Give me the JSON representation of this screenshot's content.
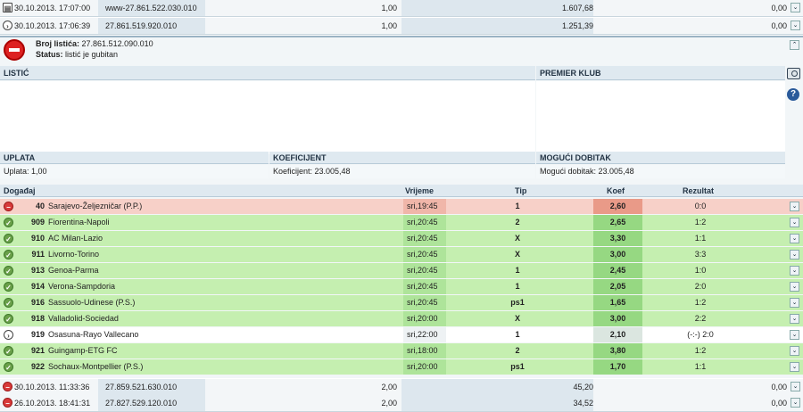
{
  "top_tickets": [
    {
      "status": "print",
      "date": "30.10.2013. 17:07:00",
      "number": "www-27.861.522.030.010",
      "stake": "1,00",
      "win": "1.607,68",
      "paid": "0,00"
    },
    {
      "status": "pending",
      "date": "30.10.2013. 17:06:39",
      "number": "27.861.519.920.010",
      "stake": "1,00",
      "win": "1.251,39",
      "paid": "0,00"
    }
  ],
  "ticket": {
    "number_label": "Broj listića:",
    "number": "27.861.512.090.010",
    "status_label": "Status:",
    "status": "listić je gubitan",
    "listic_header": "LISTIĆ",
    "club_header": "PREMIER KLUB",
    "uplata_header": "UPLATA",
    "uplata_text": "Uplata: 1,00",
    "koef_header": "KOEFICIJENT",
    "koef_text": "Koeficijent: 23.005,48",
    "dobitak_header": "MOGUĆI DOBITAK",
    "dobitak_text": "Mogući dobitak: 23.005,48"
  },
  "events_header": {
    "event": "Događaj",
    "time": "Vrijeme",
    "tip": "Tip",
    "koef": "Koef",
    "result": "Rezultat"
  },
  "events": [
    {
      "status": "lost",
      "code": "40",
      "name": "Sarajevo-Željezničar (P.P.)",
      "time": "sri,19:45",
      "tip": "1",
      "koef": "2,60",
      "result": "0:0"
    },
    {
      "status": "ok",
      "code": "909",
      "name": "Fiorentina-Napoli",
      "time": "sri,20:45",
      "tip": "2",
      "koef": "2,65",
      "result": "1:2"
    },
    {
      "status": "ok",
      "code": "910",
      "name": "AC Milan-Lazio",
      "time": "sri,20:45",
      "tip": "X",
      "koef": "3,30",
      "result": "1:1"
    },
    {
      "status": "ok",
      "code": "911",
      "name": "Livorno-Torino",
      "time": "sri,20:45",
      "tip": "X",
      "koef": "3,00",
      "result": "3:3"
    },
    {
      "status": "ok",
      "code": "913",
      "name": "Genoa-Parma",
      "time": "sri,20:45",
      "tip": "1",
      "koef": "2,45",
      "result": "1:0"
    },
    {
      "status": "ok",
      "code": "914",
      "name": "Verona-Sampdoria",
      "time": "sri,20:45",
      "tip": "1",
      "koef": "2,05",
      "result": "2:0"
    },
    {
      "status": "ok",
      "code": "916",
      "name": "Sassuolo-Udinese (P.S.)",
      "time": "sri,20:45",
      "tip": "ps1",
      "koef": "1,65",
      "result": "1:2"
    },
    {
      "status": "ok",
      "code": "918",
      "name": "Valladolid-Sociedad",
      "time": "sri,20:00",
      "tip": "X",
      "koef": "3,00",
      "result": "2:2"
    },
    {
      "status": "pending",
      "code": "919",
      "name": "Osasuna-Rayo Vallecano",
      "time": "sri,22:00",
      "tip": "1",
      "koef": "2,10",
      "result": "(-:-) 2:0"
    },
    {
      "status": "ok",
      "code": "921",
      "name": "Guingamp-ETG FC",
      "time": "sri,18:00",
      "tip": "2",
      "koef": "3,80",
      "result": "1:2"
    },
    {
      "status": "ok",
      "code": "922",
      "name": "Sochaux-Montpellier (P.S.)",
      "time": "sri,20:00",
      "tip": "ps1",
      "koef": "1,70",
      "result": "1:1"
    }
  ],
  "bottom_tickets": [
    {
      "status": "lost",
      "date": "30.10.2013. 11:33:36",
      "number": "27.859.521.630.010",
      "stake": "2,00",
      "win": "45,20",
      "paid": "0,00"
    },
    {
      "status": "lost",
      "date": "26.10.2013. 18:41:31",
      "number": "27.827.529.120.010",
      "stake": "2,00",
      "win": "34,52",
      "paid": "0,00"
    }
  ],
  "icons": {
    "print": "printer-icon",
    "pending": "pending-arrow-icon",
    "lost": "lost-icon",
    "ok": "checkmark-icon",
    "expand": "expand-chevron-icon",
    "collapse": "collapse-chevron-icon",
    "camera": "camera-icon",
    "help": "help-icon"
  }
}
